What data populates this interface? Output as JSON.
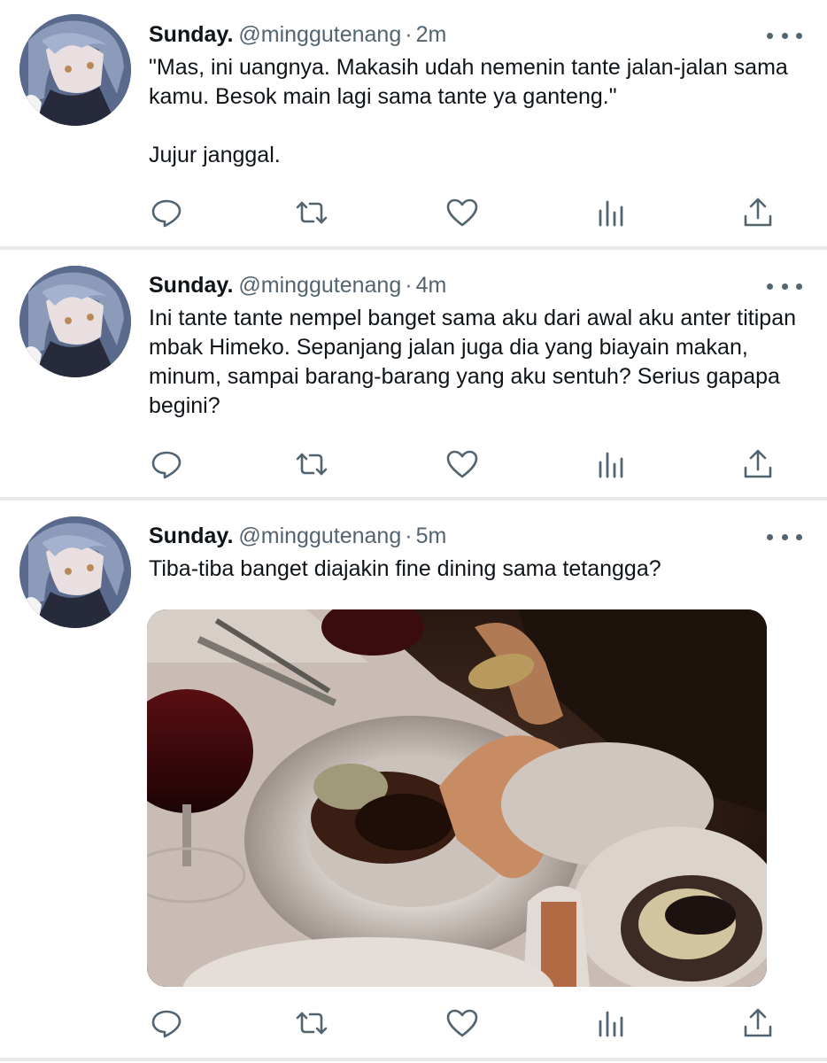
{
  "tweets": [
    {
      "name": "Sunday.",
      "handle": "@minggutenang",
      "separator": "·",
      "time": "2m",
      "text": "\"Mas, ini uangnya. Makasih udah nemenin tante jalan-jalan sama kamu. Besok main lagi sama tante ya ganteng.\"\n\nJujur janggal."
    },
    {
      "name": "Sunday.",
      "handle": "@minggutenang",
      "separator": "·",
      "time": "4m",
      "text": "Ini tante tante nempel banget sama aku dari awal aku anter titipan mbak Himeko. Sepanjang jalan juga dia yang biayain makan, minum, sampai barang-barang yang aku sentuh? Serius gapapa begini?"
    },
    {
      "name": "Sunday.",
      "handle": "@minggutenang",
      "separator": "·",
      "time": "5m",
      "text": "Tiba-tiba banget diajakin fine dining sama tetangga?"
    }
  ],
  "icons": {
    "more": "more-icon",
    "reply": "reply-icon",
    "retweet": "retweet-icon",
    "like": "heart-icon",
    "views": "analytics-icon",
    "share": "share-icon"
  },
  "colors": {
    "text": "#0f1419",
    "secondary": "#536471",
    "divider": "#e7e9eb"
  }
}
